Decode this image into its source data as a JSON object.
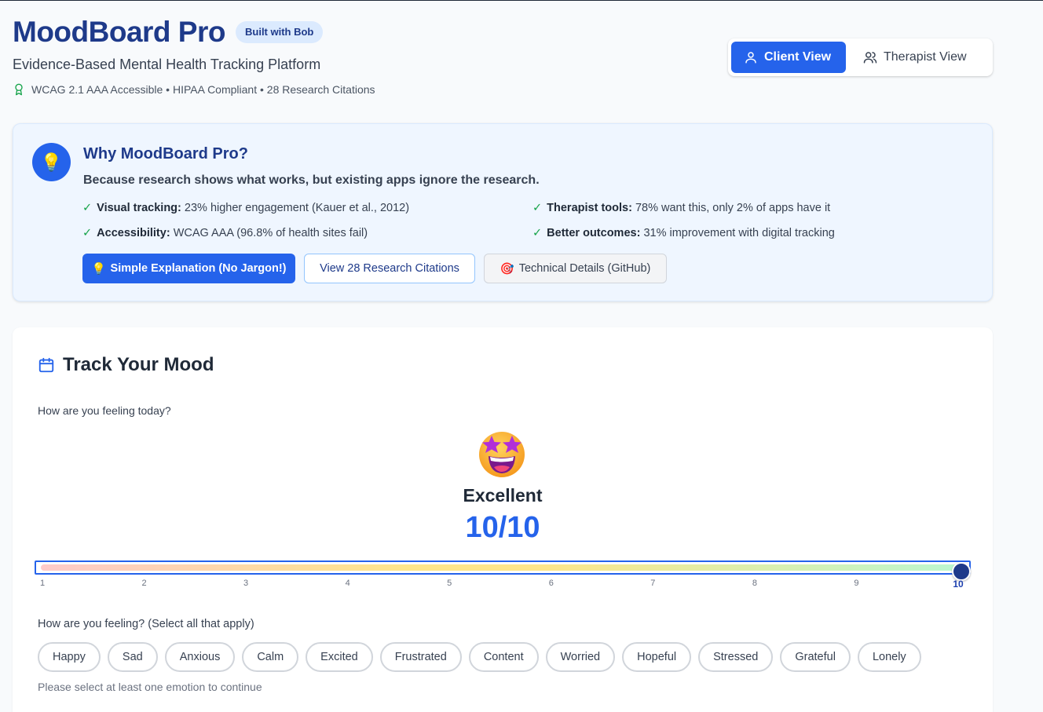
{
  "header": {
    "title": "MoodBoard Pro",
    "badge": "Built with Bob",
    "subtitle": "Evidence-Based Mental Health Tracking Platform",
    "compliance": "WCAG 2.1 AAA Accessible • HIPAA Compliant • 28 Research Citations",
    "compliance_icon": "award-icon"
  },
  "view_toggle": {
    "client_label": "Client View",
    "therapist_label": "Therapist View",
    "active": "client"
  },
  "why": {
    "icon": "lightbulb-icon",
    "title": "Why MoodBoard Pro?",
    "lead": "Because research shows what works, but existing apps ignore the research.",
    "facts": [
      {
        "label": "Visual tracking:",
        "text": "23% higher engagement (Kauer et al., 2012)"
      },
      {
        "label": "Therapist tools:",
        "text": "78% want this, only 2% of apps have it"
      },
      {
        "label": "Accessibility:",
        "text": "WCAG AAA (96.8% of health sites fail)"
      },
      {
        "label": "Better outcomes:",
        "text": "31% improvement with digital tracking"
      }
    ],
    "buttons": {
      "simple": "Simple Explanation (No Jargon!)",
      "citations": "View 28 Research Citations",
      "technical": "Technical Details (GitHub)"
    }
  },
  "track": {
    "title": "Track Your Mood",
    "question": "How are you feeling today?",
    "emoji": "star-struck-emoji",
    "mood_label": "Excellent",
    "mood_score": "10/10",
    "slider": {
      "min": 1,
      "max": 10,
      "value": 10,
      "ticks": [
        "1",
        "2",
        "3",
        "4",
        "5",
        "6",
        "7",
        "8",
        "9",
        "10"
      ]
    },
    "emotions_question": "How are you feeling? (Select all that apply)",
    "emotions": [
      "Happy",
      "Sad",
      "Anxious",
      "Calm",
      "Excited",
      "Frustrated",
      "Content",
      "Worried",
      "Hopeful",
      "Stressed",
      "Grateful",
      "Lonely"
    ],
    "hint": "Please select at least one emotion to continue"
  },
  "colors": {
    "primary": "#2563eb",
    "title": "#1e3a8a",
    "check": "#16a34a",
    "panel": "#eff6ff"
  }
}
